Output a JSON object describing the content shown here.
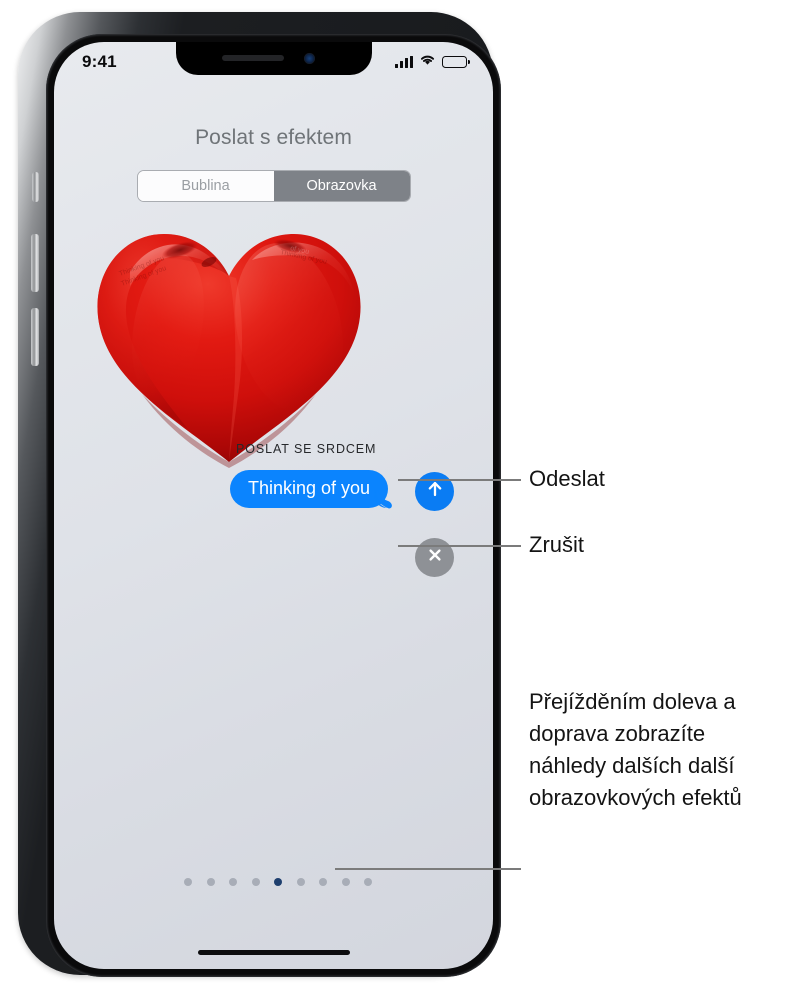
{
  "device": {
    "status_bar": {
      "time": "9:41",
      "cellular_icon": "signal-bars-icon",
      "wifi_icon": "wifi-icon",
      "battery_icon": "battery-full-icon"
    },
    "notch": {
      "speaker_icon": "speaker-grille-icon",
      "camera_icon": "front-camera-icon"
    },
    "home_indicator": "home-indicator"
  },
  "screen": {
    "title": "Poslat s efektem",
    "segmented_control": {
      "options": [
        {
          "label": "Bublina",
          "selected": false
        },
        {
          "label": "Obrazovka",
          "selected": true
        }
      ]
    },
    "effect_preview": {
      "artwork": "red-heart-balloon",
      "caption": "POSLAT SE SRDCEM"
    },
    "message": {
      "text": "Thinking of you",
      "bubble_color": "#0b84fe"
    },
    "send_button": {
      "icon": "arrow-up-icon",
      "color": "#0a7cf3"
    },
    "cancel_button": {
      "icon": "close-x-icon",
      "color": "#8e9196"
    },
    "page_dots": {
      "count": 9,
      "active_index": 4,
      "active_color": "#1e3f6e",
      "inactive_color": "#a8adb7"
    }
  },
  "callouts": {
    "send": "Odeslat",
    "cancel": "Zrušit",
    "swipe": "Přejížděním doleva a doprava zobrazíte náhledy dalších další obrazovkových efektů"
  }
}
